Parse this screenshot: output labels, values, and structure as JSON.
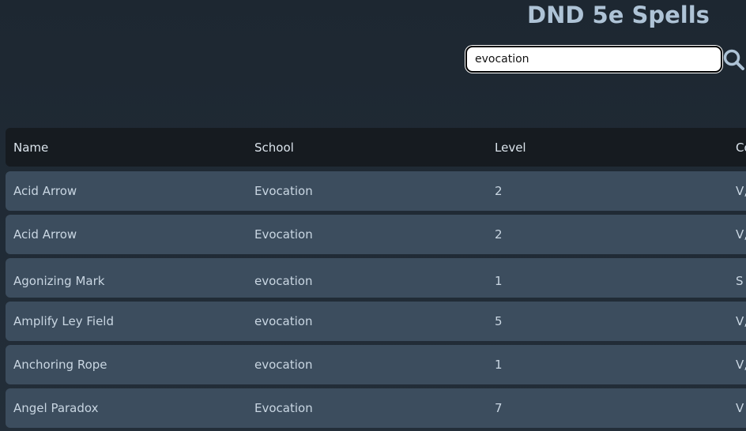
{
  "header": {
    "title": "DND 5e Spells"
  },
  "search": {
    "value": "evocation",
    "placeholder": ""
  },
  "table": {
    "columns": {
      "name": "Name",
      "school": "School",
      "level": "Level",
      "components": "Co"
    },
    "rows": [
      {
        "name": "Acid Arrow",
        "school": "Evocation",
        "level": "2",
        "components": "V,"
      },
      {
        "name": "Acid Arrow",
        "school": "Evocation",
        "level": "2",
        "components": "V,"
      },
      {
        "name": "Agonizing Mark",
        "school": "evocation",
        "level": "1",
        "components": "S"
      },
      {
        "name": "Amplify Ley Field",
        "school": "evocation",
        "level": "5",
        "components": "V,"
      },
      {
        "name": "Anchoring Rope",
        "school": "evocation",
        "level": "1",
        "components": "V,"
      },
      {
        "name": "Angel Paradox",
        "school": "Evocation",
        "level": "7",
        "components": "V"
      }
    ]
  },
  "colors": {
    "background": "#1f2a35",
    "title": "#aec3d6",
    "header_row": "#161b20",
    "data_row": "#3c4d5e",
    "text": "#c9d6e2"
  },
  "icons": {
    "search": "search-icon"
  }
}
